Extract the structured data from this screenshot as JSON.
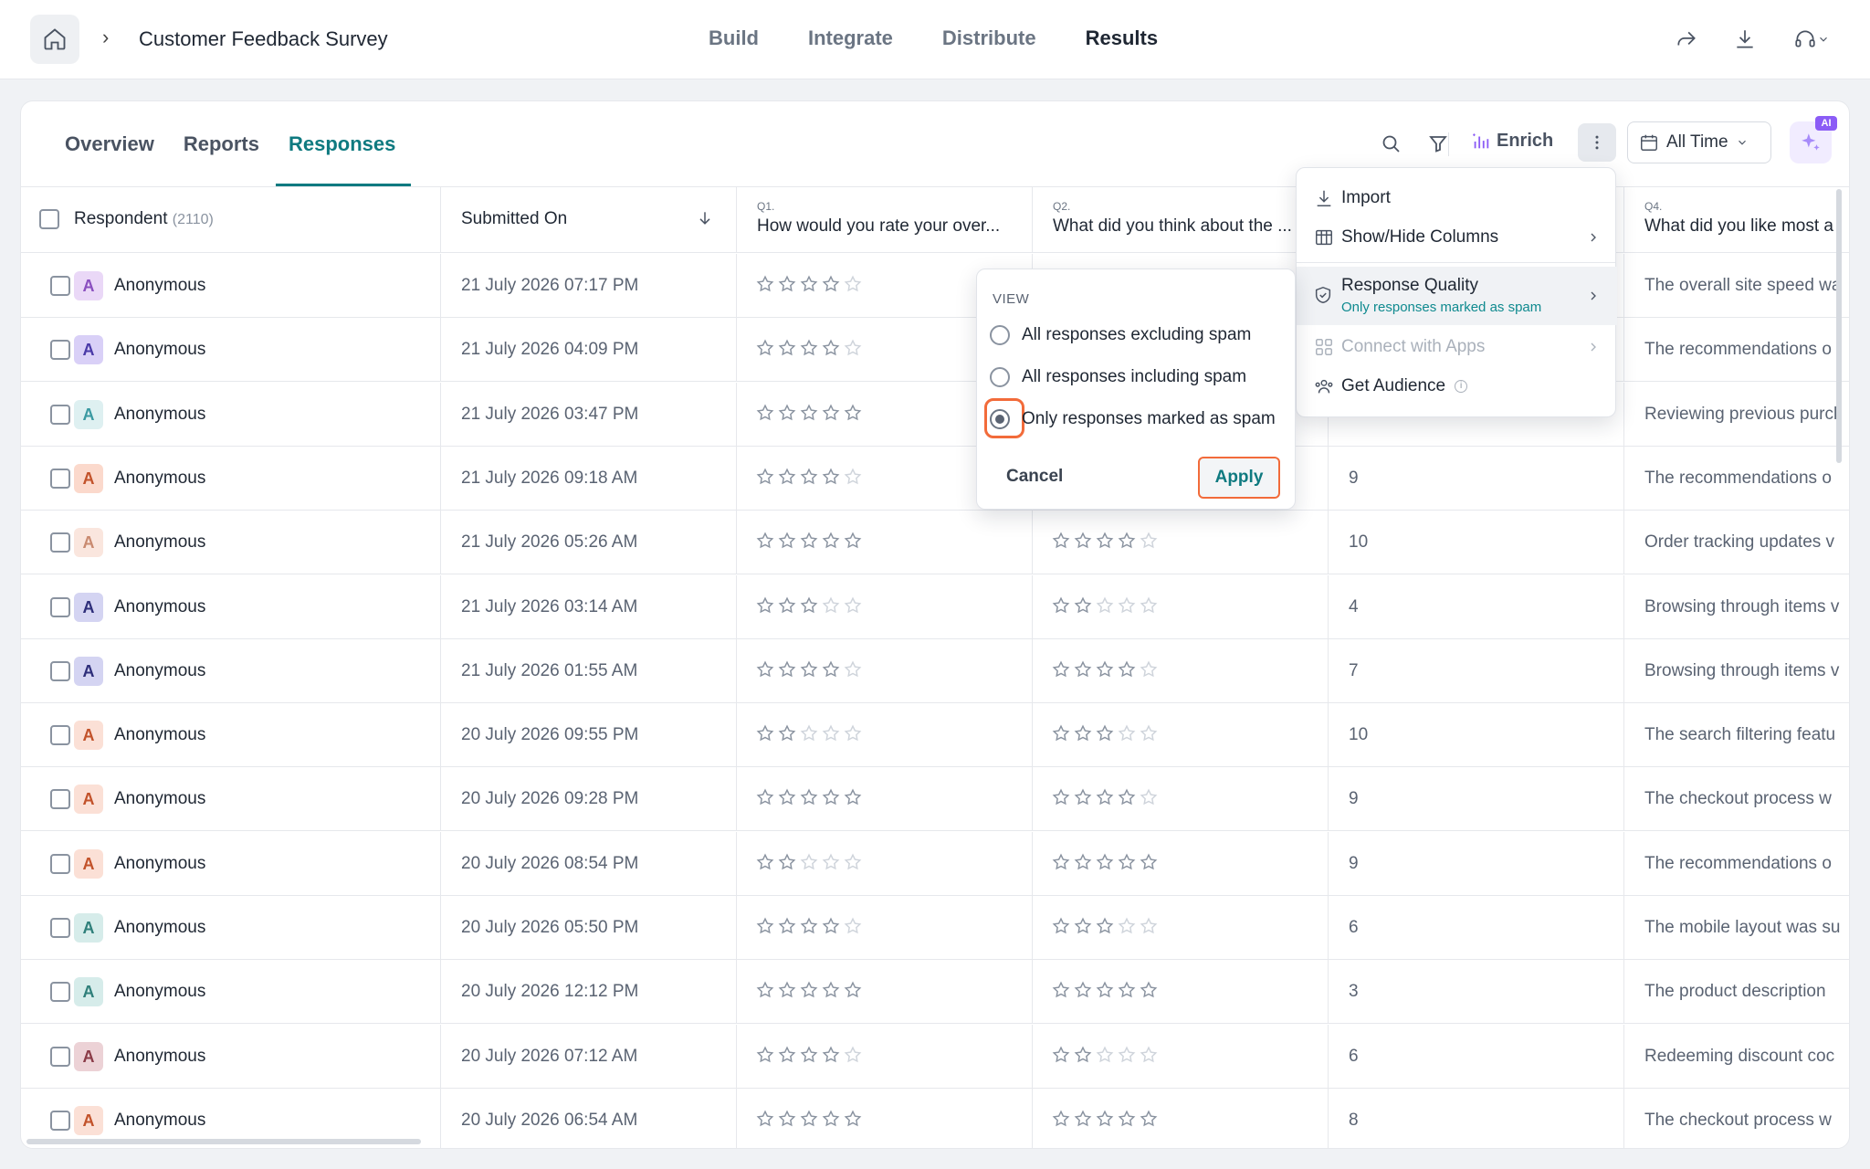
{
  "header": {
    "survey_title": "Customer Feedback Survey",
    "nav": [
      "Build",
      "Integrate",
      "Distribute",
      "Results"
    ],
    "active_nav": "Results"
  },
  "subtabs": {
    "items": [
      "Overview",
      "Reports",
      "Responses"
    ],
    "active": "Responses"
  },
  "toolbar": {
    "enrich_label": "Enrich",
    "date_range": "All Time",
    "ai_badge": "AI"
  },
  "table": {
    "columns": {
      "respondent": "Respondent",
      "respondent_count": "(2110)",
      "submitted": "Submitted On",
      "q1_num": "Q1.",
      "q1_text": "How would you rate your over...",
      "q2_num": "Q2.",
      "q2_text": "What did you think about the ...",
      "q4_num": "Q4.",
      "q4_text": "What did you like most a"
    },
    "rows": [
      {
        "name": "Anonymous",
        "avatar": "A",
        "avatar_bg": "#ead8f7",
        "avatar_fg": "#8a4fbf",
        "submitted": "21 July 2026 07:17 PM",
        "q1": 4,
        "q2": null,
        "q3": "",
        "q4": "The overall site speed wa"
      },
      {
        "name": "Anonymous",
        "avatar": "A",
        "avatar_bg": "#d9d0f7",
        "avatar_fg": "#4a3aa8",
        "submitted": "21 July 2026 04:09 PM",
        "q1": 4,
        "q2": null,
        "q3": "",
        "q4": "The recommendations o"
      },
      {
        "name": "Anonymous",
        "avatar": "A",
        "avatar_bg": "#def0f1",
        "avatar_fg": "#3b9aa2",
        "submitted": "21 July 2026 03:47 PM",
        "q1": 5,
        "q2": null,
        "q3": "",
        "q4": "Reviewing previous purcl"
      },
      {
        "name": "Anonymous",
        "avatar": "A",
        "avatar_bg": "#fbd9cc",
        "avatar_fg": "#c2522a",
        "submitted": "21 July 2026 09:18 AM",
        "q1": 4,
        "q2": null,
        "q3": "9",
        "q4": "The recommendations o"
      },
      {
        "name": "Anonymous",
        "avatar": "A",
        "avatar_bg": "#fae6de",
        "avatar_fg": "#c98a70",
        "submitted": "21 July 2026 05:26 AM",
        "q1": 5,
        "q2": 4,
        "q3": "10",
        "q4": "Order tracking updates v"
      },
      {
        "name": "Anonymous",
        "avatar": "A",
        "avatar_bg": "#d4d4f2",
        "avatar_fg": "#2e2e7a",
        "submitted": "21 July 2026 03:14 AM",
        "q1": 3,
        "q2": 2,
        "q3": "4",
        "q4": "Browsing through items v"
      },
      {
        "name": "Anonymous",
        "avatar": "A",
        "avatar_bg": "#d4d4f2",
        "avatar_fg": "#2e2e7a",
        "submitted": "21 July 2026 01:55 AM",
        "q1": 4,
        "q2": 4,
        "q3": "7",
        "q4": "Browsing through items v"
      },
      {
        "name": "Anonymous",
        "avatar": "A",
        "avatar_bg": "#fbe0d6",
        "avatar_fg": "#c2522a",
        "submitted": "20 July 2026 09:55 PM",
        "q1": 2,
        "q2": 3,
        "q3": "10",
        "q4": "The search filtering featu"
      },
      {
        "name": "Anonymous",
        "avatar": "A",
        "avatar_bg": "#fbe0d6",
        "avatar_fg": "#c2522a",
        "submitted": "20 July 2026 09:28 PM",
        "q1": 5,
        "q2": 4,
        "q3": "9",
        "q4": "The checkout process w"
      },
      {
        "name": "Anonymous",
        "avatar": "A",
        "avatar_bg": "#fbe0d6",
        "avatar_fg": "#c2522a",
        "submitted": "20 July 2026 08:54 PM",
        "q1": 2,
        "q2": 5,
        "q3": "9",
        "q4": "The recommendations o"
      },
      {
        "name": "Anonymous",
        "avatar": "A",
        "avatar_bg": "#d6ecea",
        "avatar_fg": "#2f7f7a",
        "submitted": "20 July 2026 05:50 PM",
        "q1": 4,
        "q2": 3,
        "q3": "6",
        "q4": "The mobile layout was su"
      },
      {
        "name": "Anonymous",
        "avatar": "A",
        "avatar_bg": "#d6ecea",
        "avatar_fg": "#2f7f7a",
        "submitted": "20 July 2026 12:12 PM",
        "q1": 5,
        "q2": 5,
        "q3": "3",
        "q4": "The product description"
      },
      {
        "name": "Anonymous",
        "avatar": "A",
        "avatar_bg": "#ecd2d6",
        "avatar_fg": "#8a3b47",
        "submitted": "20 July 2026 07:12 AM",
        "q1": 4,
        "q2": 2,
        "q3": "6",
        "q4": "Redeeming discount coc"
      },
      {
        "name": "Anonymous",
        "avatar": "A",
        "avatar_bg": "#fbe0d6",
        "avatar_fg": "#c2522a",
        "submitted": "20 July 2026 06:54 AM",
        "q1": 5,
        "q2": 5,
        "q3": "8",
        "q4": "The checkout process w"
      }
    ]
  },
  "more_menu": {
    "import": "Import",
    "show_hide": "Show/Hide Columns",
    "quality": "Response Quality",
    "quality_sub": "Only responses marked as spam",
    "connect": "Connect with Apps",
    "audience": "Get Audience"
  },
  "spam_popover": {
    "heading": "VIEW",
    "options": [
      "All responses excluding spam",
      "All responses including spam",
      "Only responses marked as spam"
    ],
    "selected": 2,
    "cancel": "Cancel",
    "apply": "Apply"
  },
  "colors": {
    "accent": "#0f7a80",
    "highlight": "#f26b3a",
    "star": "#8a93a0"
  }
}
